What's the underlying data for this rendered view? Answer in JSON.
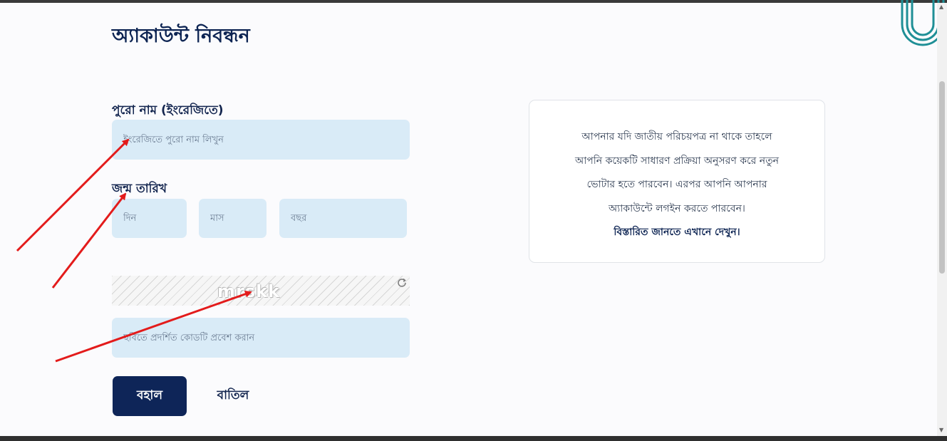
{
  "page": {
    "title": "অ্যাকাউন্ট নিবন্ধন"
  },
  "form": {
    "full_name_label": "পুরো নাম (ইংরেজিতে)",
    "full_name_placeholder": "ইংরেজিতে পুরো নাম লিখুন",
    "dob_label": "জন্ম তারিখ",
    "day_placeholder": "দিন",
    "month_placeholder": "মাস",
    "year_placeholder": "বছর",
    "captcha_text": "mrskk",
    "captcha_input_placeholder": "ছবিতে প্রদর্শিত কোডটি প্রবেশ করান",
    "submit_label": "বহাল",
    "cancel_label": "বাতিল"
  },
  "info": {
    "lines": [
      "আপনার যদি জাতীয় পরিচয়পত্র না থাকে তাহলে",
      "আপনি কয়েকটি সাধারণ প্রক্রিয়া অনুসরণ করে নতুন",
      "ভোটার হতে পারবেন। এরপর আপনি আপনার",
      "অ্যাকাউন্টে লগইন করতে পারবেন।"
    ],
    "link": "বিস্তারিত জানতে এখানে দেখুন।"
  },
  "colors": {
    "primary": "#0e2558",
    "input_bg": "#d9ebf7",
    "annotation_arrow": "#e31b1b",
    "logo": "#1f8f96"
  },
  "icons": {
    "logo": "u-logo-icon",
    "refresh": "refresh-icon",
    "annotations": "red-arrow-icon"
  }
}
